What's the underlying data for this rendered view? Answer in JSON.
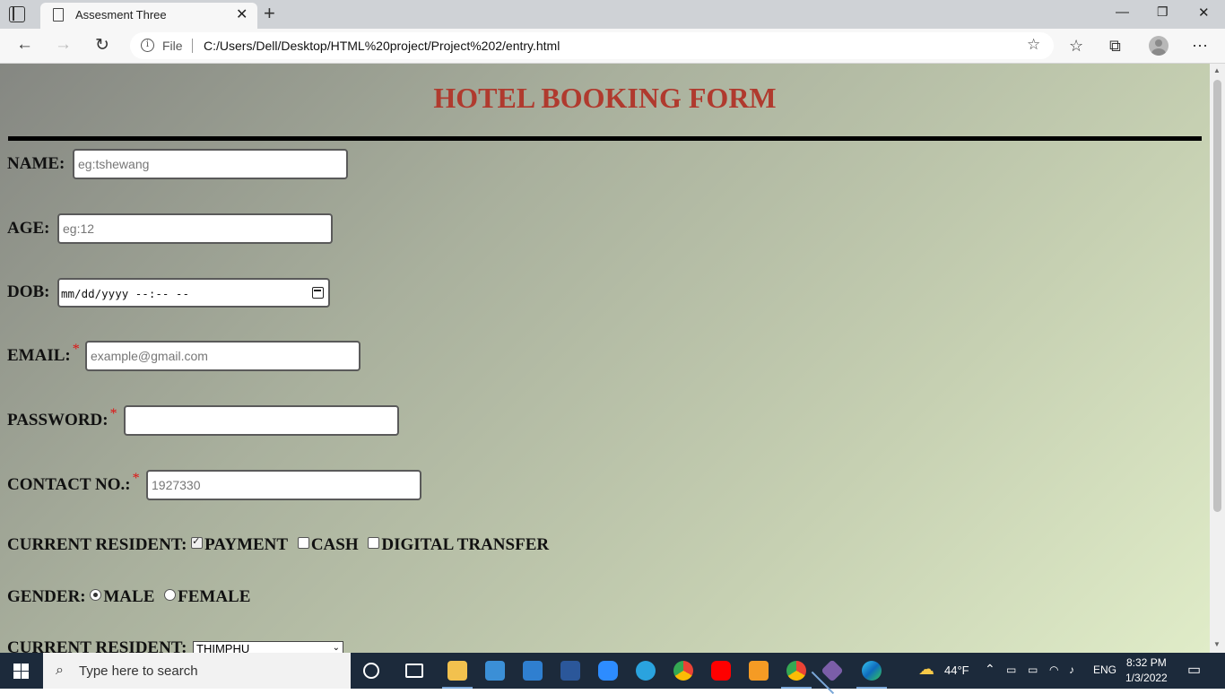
{
  "browser": {
    "tab_title": "Assesment Three",
    "url_scheme_label": "File",
    "url": "C:/Users/Dell/Desktop/HTML%20project/Project%202/entry.html"
  },
  "page": {
    "heading": "HOTEL BOOKING FORM",
    "name": {
      "label": "NAME:",
      "placeholder": "eg:tshewang"
    },
    "age": {
      "label": "AGE:",
      "placeholder": "eg:12"
    },
    "dob": {
      "label": "DOB:",
      "value": "mm/dd/yyyy --:-- --"
    },
    "email": {
      "label": "EMAIL:",
      "required_mark": "*",
      "placeholder": "example@gmail.com"
    },
    "password": {
      "label": "PASSWORD:",
      "required_mark": "*",
      "value": ""
    },
    "contact": {
      "label": "CONTACT NO.:",
      "required_mark": "*",
      "placeholder": "1927330"
    },
    "payment_group": {
      "label": "CURRENT RESIDENT:",
      "options": [
        {
          "label": "PAYMENT",
          "checked": true
        },
        {
          "label": "CASH",
          "checked": false
        },
        {
          "label": "DIGITAL TRANSFER",
          "checked": false
        }
      ]
    },
    "gender": {
      "label": "GENDER:",
      "options": [
        {
          "label": "MALE",
          "selected": true
        },
        {
          "label": "FEMALE",
          "selected": false
        }
      ]
    },
    "residence": {
      "label": "CURRENT RESIDENT:",
      "selected": "THIMPHU"
    }
  },
  "taskbar": {
    "search_placeholder": "Type here to search",
    "weather": "44°F",
    "language": "ENG",
    "time": "8:32 PM",
    "date": "1/3/2022"
  },
  "colors": {
    "heading": "#b03a2e",
    "required": "#e01010",
    "taskbar": "#1c2a3b"
  }
}
